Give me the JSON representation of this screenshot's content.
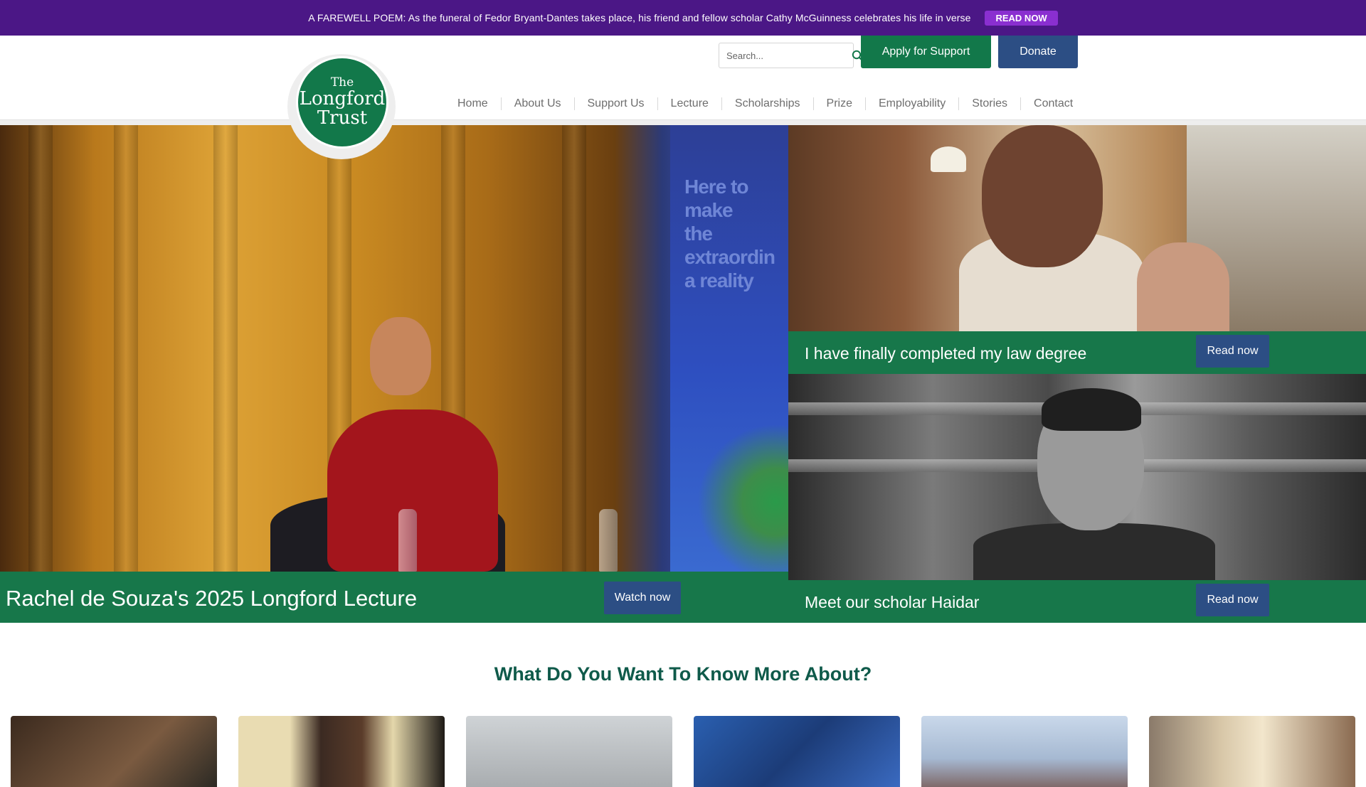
{
  "announcement": {
    "text": "A FAREWELL POEM: As the funeral of Fedor Bryant-Dantes takes place, his friend and fellow scholar Cathy McGuinness celebrates his life in verse",
    "button_label": "READ NOW"
  },
  "logo": {
    "line1": "The",
    "line2": "Longford",
    "line3": "Trust"
  },
  "search": {
    "placeholder": "Search...",
    "icon": "search-icon"
  },
  "header_buttons": {
    "apply_label": "Apply for Support",
    "donate_label": "Donate"
  },
  "nav": {
    "items": [
      "Home",
      "About Us",
      "Support Us",
      "Lecture",
      "Scholarships",
      "Prize",
      "Employability",
      "Stories",
      "Contact"
    ]
  },
  "hero": {
    "main": {
      "title": "Rachel de Souza's 2025 Longford Lecture",
      "button_label": "Watch now",
      "backdrop_text": [
        "Here to make",
        "the extraordin",
        "a reality"
      ]
    },
    "stories": [
      {
        "title": "I have finally completed my law degree",
        "button_label": "Read now"
      },
      {
        "title": "Meet our scholar Haidar",
        "button_label": "Read now"
      }
    ]
  },
  "section": {
    "title": "What Do You Want To Know More About?"
  },
  "colors": {
    "announcement_bg": "#4b1786",
    "announcement_button": "#8a2fd0",
    "brand_green": "#12784a",
    "caption_green": "#17774a",
    "navy": "#2c4e84",
    "heading": "#0f5a4a"
  }
}
